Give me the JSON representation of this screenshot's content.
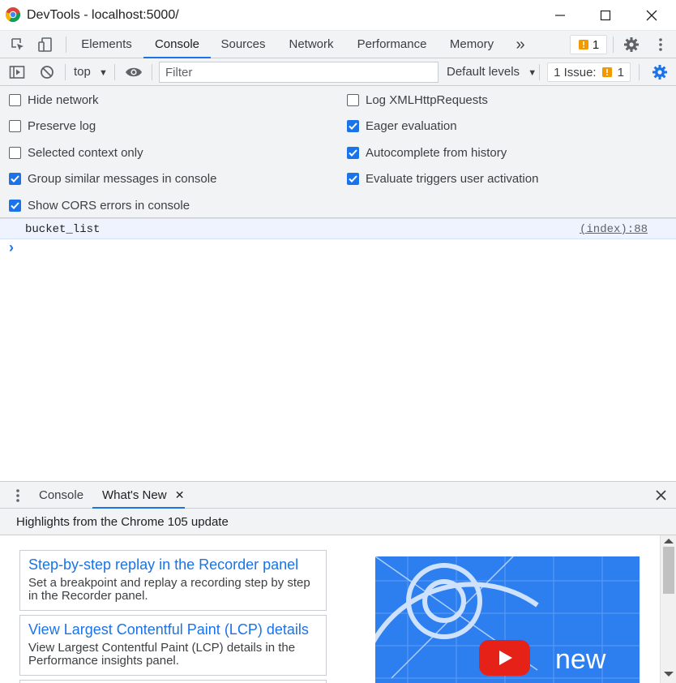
{
  "window": {
    "title": "DevTools - localhost:5000/"
  },
  "tabs": {
    "items": [
      "Elements",
      "Console",
      "Sources",
      "Network",
      "Performance",
      "Memory"
    ],
    "active": "Console",
    "more_label": "»",
    "issues_count": "1"
  },
  "toolbar": {
    "context": "top",
    "filter_placeholder": "Filter",
    "levels": "Default levels",
    "issues_label": "1 Issue:",
    "issues_count": "1"
  },
  "settings": {
    "left": [
      {
        "label": "Hide network",
        "checked": false
      },
      {
        "label": "Preserve log",
        "checked": false
      },
      {
        "label": "Selected context only",
        "checked": false
      },
      {
        "label": "Group similar messages in console",
        "checked": true
      },
      {
        "label": "Show CORS errors in console",
        "checked": true
      }
    ],
    "right": [
      {
        "label": "Log XMLHttpRequests",
        "checked": false
      },
      {
        "label": "Eager evaluation",
        "checked": true
      },
      {
        "label": "Autocomplete from history",
        "checked": true
      },
      {
        "label": "Evaluate triggers user activation",
        "checked": true
      }
    ]
  },
  "console": {
    "message": "bucket_list",
    "source": "(index):88",
    "prompt": "›"
  },
  "drawer": {
    "tabs": [
      "Console",
      "What's New"
    ],
    "active": "What's New",
    "header": "Highlights from the Chrome 105 update",
    "cards": [
      {
        "title": "Step-by-step replay in the Recorder panel",
        "desc": "Set a breakpoint and replay a recording step by step in the Recorder panel."
      },
      {
        "title": "View Largest Contentful Paint (LCP) details",
        "desc": "View Largest Contentful Paint (LCP) details in the Performance insights panel."
      }
    ],
    "video_text": "new"
  },
  "colors": {
    "accent": "#1a73e8",
    "warning": "#f29900",
    "youtube_red": "#e62117"
  }
}
